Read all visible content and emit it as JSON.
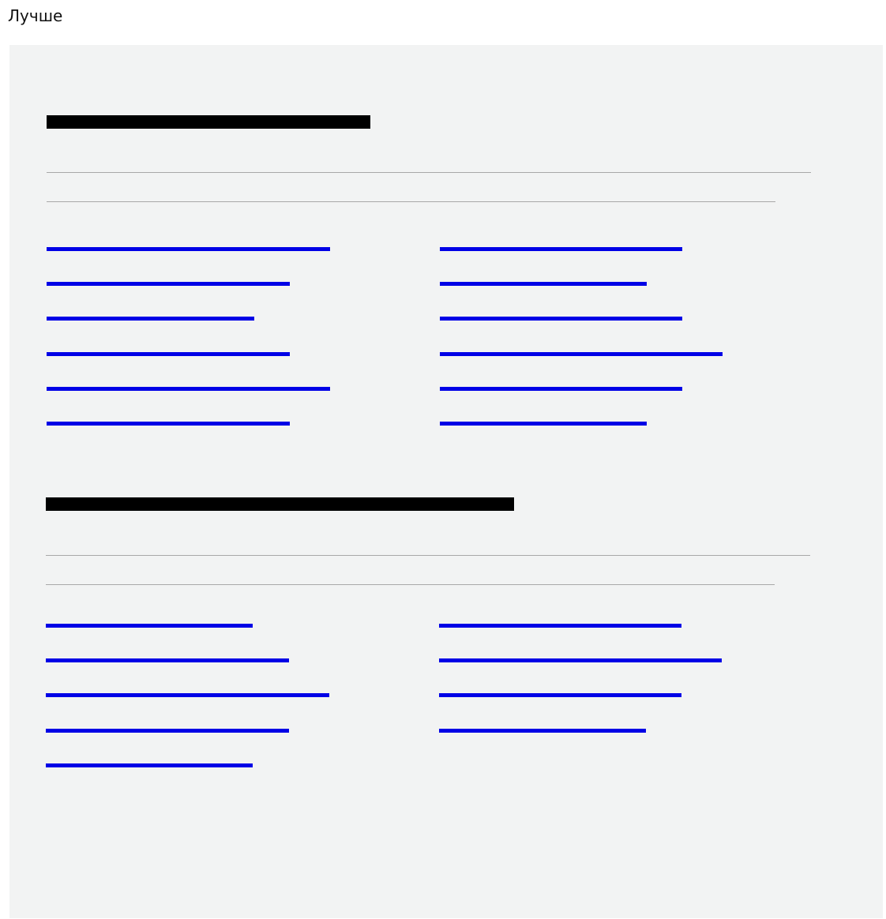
{
  "page": {
    "title": "Лучше"
  },
  "colors": {
    "panel_background": "#f2f3f3",
    "heading_placeholder": "#000000",
    "rule": "#a8a8a8",
    "link_placeholder": "#0000e6"
  }
}
